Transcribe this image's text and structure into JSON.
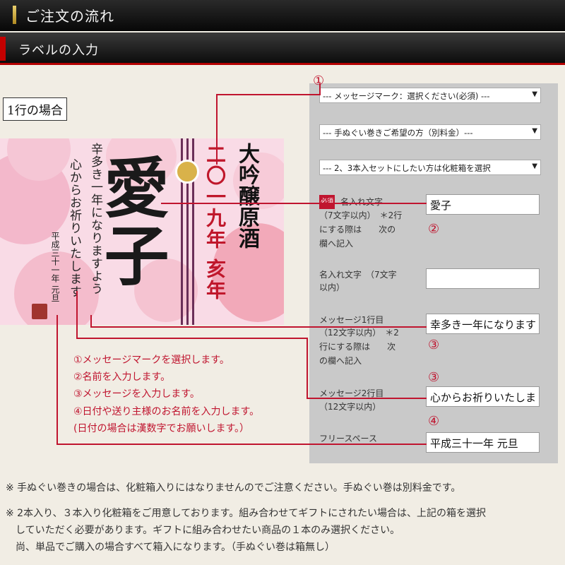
{
  "header": {
    "title": "ご注文の流れ",
    "subtitle": "ラベルの入力"
  },
  "case_label": "1行の場合",
  "label_preview": {
    "name": "愛子",
    "message_line1": "辛多き一年になりますよう",
    "message_line2": "心からお祈りいたします",
    "date": "平成三十一年 元旦",
    "product": "大吟醸原酒",
    "year": "二〇一九年 亥年"
  },
  "form": {
    "selects": [
      {
        "value": "--- メッセージマーク：選択ください(必須) ---"
      },
      {
        "value": "--- 手ぬぐい巻きご希望の方（別料金）---"
      },
      {
        "value": "--- 2、3本入セットにしたい方は化粧箱を選択"
      }
    ],
    "required_badge": "必須",
    "name_label": "名入れ文字",
    "name_hint": "（7文字以内）　＊2行",
    "name_hint2": "にする際は　　次の",
    "name_hint3": "欄へ記入",
    "name_value": "愛子",
    "name2_label": "名入れ文字　（7文字",
    "name2_label2": "以内）",
    "name2_value": "",
    "msg1_label": "メッセージ1行目",
    "msg1_hint": "（12文字以内）　＊2",
    "msg1_hint2": "行にする際は　　次",
    "msg1_hint3": "の欄へ記入",
    "msg1_value": "幸多き一年になります",
    "msg2_label": "メッセージ2行目",
    "msg2_hint": "（12文字以内）",
    "msg2_value": "心からお祈りいたしま",
    "free_label": "フリースペース",
    "free_value": "平成三十一年 元旦",
    "markers": {
      "m1": "①",
      "m2": "②",
      "m3a": "③",
      "m3b": "③",
      "m4": "④"
    }
  },
  "instructions": [
    "①メッセージマークを選択します。",
    "②名前を入力します。",
    "③メッセージを入力します。",
    "④日付や送り主様のお名前を入力します。",
    "(日付の場合は漢数字でお願いします。）"
  ],
  "notes": [
    "※ 手ぬぐい巻きの場合は、化粧箱入りにはなりませんのでご注意ください。手ぬぐい巻は別料金です。",
    "※ 2本入り、３本入り化粧箱をご用意しております。組み合わせてギフトにされたい場合は、上記の箱を選択",
    "　していただく必要があります。ギフトに組み合わせたい商品の１本のみ選択ください。",
    "　尚、単品でご購入の場合すべて箱入になります。（手ぬぐい巻は箱無し）"
  ],
  "colors": {
    "accent": "#c0152f",
    "panel": "#c9c9c9",
    "label_bg": "#f9dbe6"
  }
}
